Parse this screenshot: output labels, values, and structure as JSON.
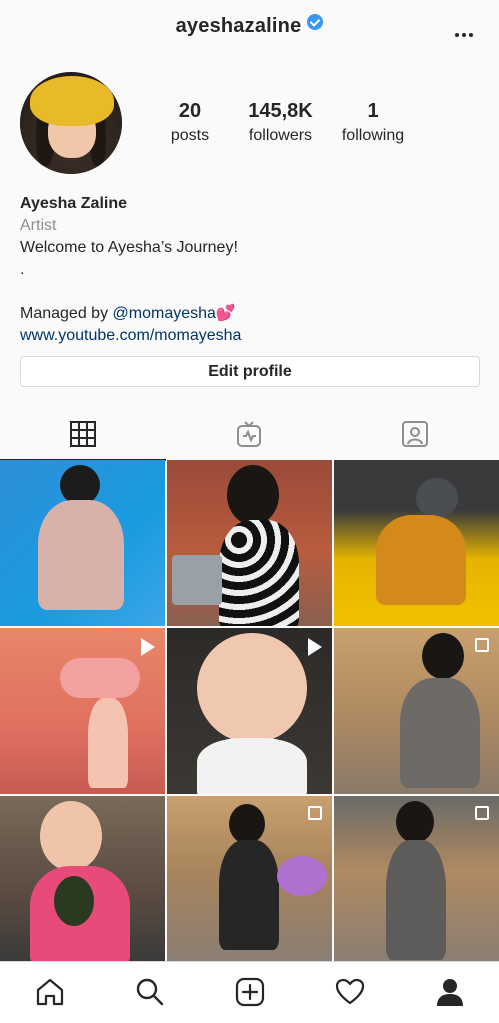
{
  "header": {
    "username": "ayeshazaline"
  },
  "stats": {
    "posts_count": "20",
    "posts_label": "posts",
    "followers_count": "145,8K",
    "followers_label": "followers",
    "following_count": "1",
    "following_label": "following"
  },
  "bio": {
    "name": "Ayesha Zaline",
    "category": "Artist",
    "line1": "Welcome to Ayesha’s Journey!",
    "line2": ".",
    "managed_prefix": "Managed by ",
    "managed_handle": "@momayesha",
    "managed_emoji": "💕",
    "website": "www.youtube.com/momayesha"
  },
  "actions": {
    "edit_profile": "Edit profile"
  },
  "tabs": [
    {
      "icon": "grid-icon",
      "active": true
    },
    {
      "icon": "igtv-icon",
      "active": false
    },
    {
      "icon": "tagged-icon",
      "active": false
    }
  ],
  "grid_posts": [
    {
      "badge": "none"
    },
    {
      "badge": "none"
    },
    {
      "badge": "none"
    },
    {
      "badge": "video"
    },
    {
      "badge": "video"
    },
    {
      "badge": "carousel"
    },
    {
      "badge": "none"
    },
    {
      "badge": "carousel"
    },
    {
      "badge": "carousel"
    }
  ],
  "bottom_nav": [
    "home-icon",
    "search-icon",
    "new-post-icon",
    "activity-icon",
    "profile-icon"
  ],
  "colors": {
    "verified": "#3897f0",
    "link": "#003569",
    "muted": "#8e8e8e",
    "border": "#dbdbdb"
  }
}
